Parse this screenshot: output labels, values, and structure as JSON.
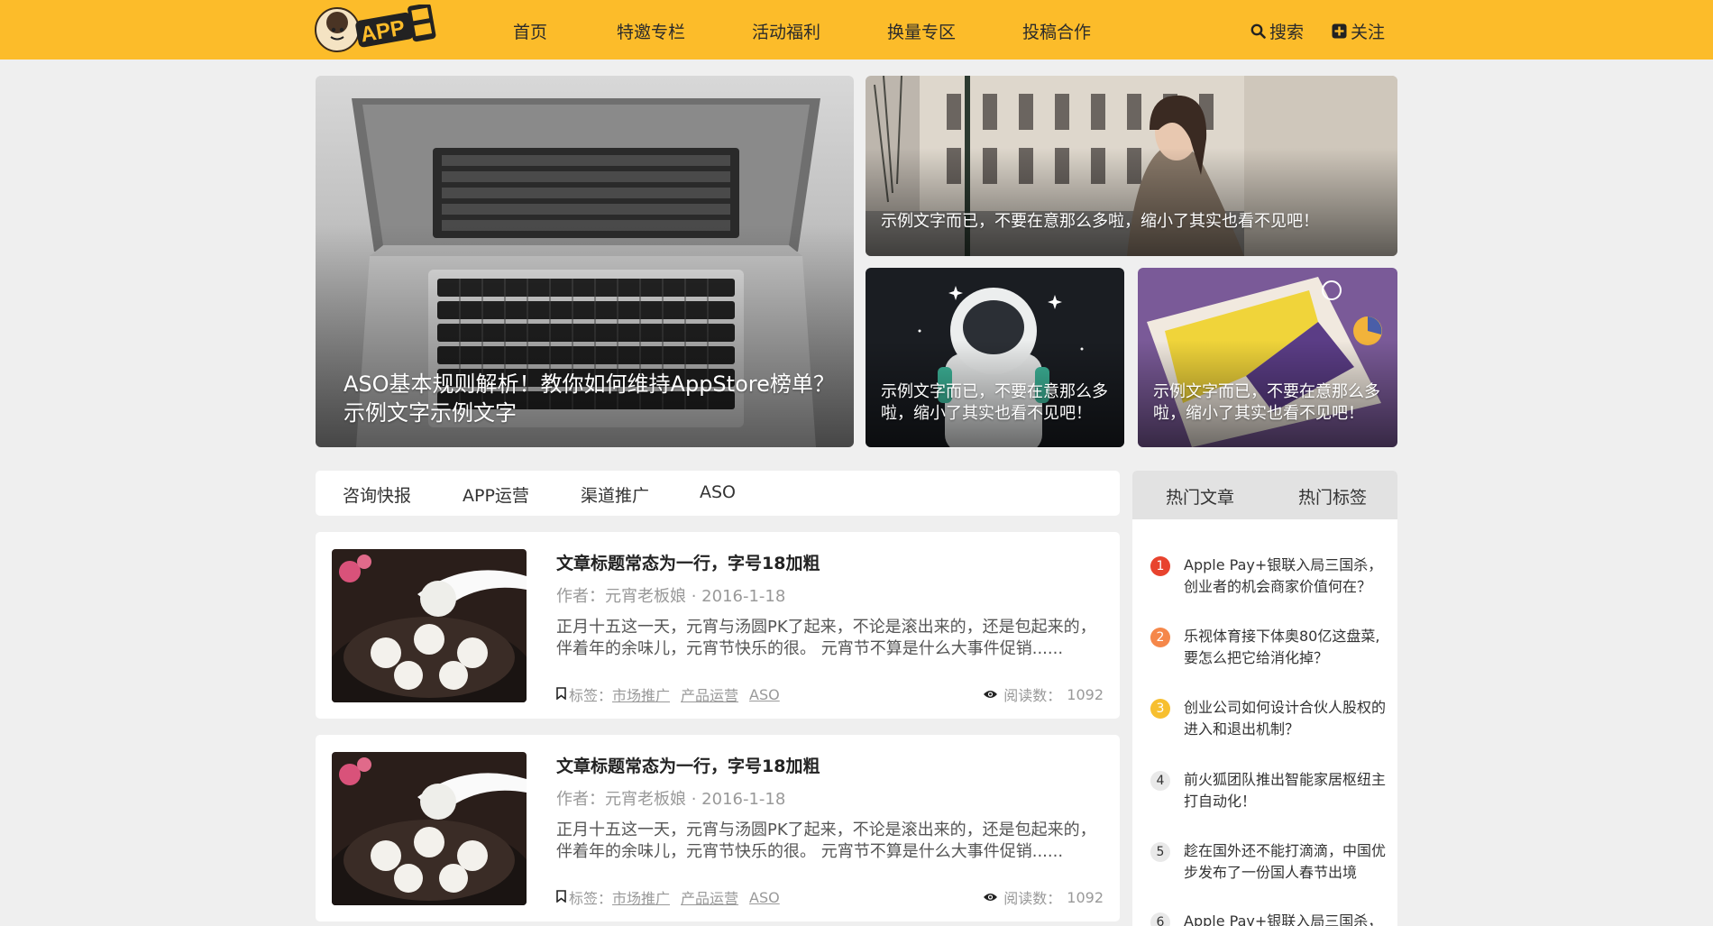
{
  "header": {
    "logo_alt": "APP干货铺子",
    "nav": [
      "首页",
      "特邀专栏",
      "活动福利",
      "换量专区",
      "投稿合作"
    ],
    "search_label": "搜索",
    "follow_label": "关注",
    "accent_color": "#fcbc2a"
  },
  "banner": {
    "main_caption": "ASO基本规则解析！教你如何维持AppStore榜单？示例文字示例文字",
    "top_right_caption": "示例文字而已，不要在意那么多啦，缩小了其实也看不见吧！",
    "bottom_mid_caption": "示例文字而已，不要在意那么多啦，缩小了其实也看不见吧！",
    "bottom_right_caption": "示例文字而已，不要在意那么多啦，缩小了其实也看不见吧！"
  },
  "categories": [
    "咨询快报",
    "APP运营",
    "渠道推广",
    "ASO"
  ],
  "articles": [
    {
      "title": "文章标题常态为一行，字号18加粗",
      "meta": "作者：元宵老板娘 · 2016-1-18",
      "excerpt": "正月十五这一天，元宵与汤圆PK了起来，不论是滚出来的，还是包起来的，伴着年的余味儿，元宵节快乐的很。 元宵节不算是什么大事件促销......",
      "tags_label": "标签：",
      "tags": [
        "市场推广",
        "产品运营",
        "ASO"
      ],
      "reads_label": "阅读数：",
      "reads": "1092"
    },
    {
      "title": "文章标题常态为一行，字号18加粗",
      "meta": "作者：元宵老板娘 · 2016-1-18",
      "excerpt": "正月十五这一天，元宵与汤圆PK了起来，不论是滚出来的，还是包起来的，伴着年的余味儿，元宵节快乐的很。 元宵节不算是什么大事件促销......",
      "tags_label": "标签：",
      "tags": [
        "市场推广",
        "产品运营",
        "ASO"
      ],
      "reads_label": "阅读数：",
      "reads": "1092"
    }
  ],
  "sidebar": {
    "tabs": [
      "热门文章",
      "热门标签"
    ],
    "hot": [
      {
        "num": "1",
        "text": "Apple Pay+银联入局三国杀，创业者的机会商家价值何在？",
        "color": "#e8432e"
      },
      {
        "num": "2",
        "text": "乐视体育接下体奥80亿这盘菜, 要怎么把它给消化掉？",
        "color": "#f5874a"
      },
      {
        "num": "3",
        "text": "创业公司如何设计合伙人股权的进入和退出机制？",
        "color": "#f7bf2f"
      },
      {
        "num": "4",
        "text": "前火狐团队推出智能家居枢纽主打自动化！",
        "color": ""
      },
      {
        "num": "5",
        "text": "趁在国外还不能打滴滴，中国优步发布了一份国人春节出境",
        "color": ""
      },
      {
        "num": "6",
        "text": "Apple Pay+银联入局三国杀，",
        "color": ""
      }
    ]
  }
}
